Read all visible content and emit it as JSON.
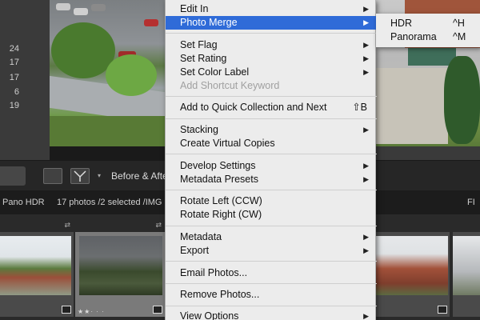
{
  "left_panel": {
    "numbers": [
      "24",
      "17",
      "17",
      "6",
      "19"
    ]
  },
  "toolbar": {
    "before_after_label": "Before & After",
    "filter_label": "FI"
  },
  "filmbar": {
    "folder_label": "Pano HDR",
    "status_text": "17 photos /2 selected /IMG"
  },
  "filmstrip": {
    "rating_stars": "★★· · ·"
  },
  "menu": {
    "edit_in": "Edit In",
    "photo_merge": "Photo Merge",
    "set_flag": "Set Flag",
    "set_rating": "Set Rating",
    "set_color_label": "Set Color Label",
    "add_shortcut_keyword": "Add Shortcut Keyword",
    "add_quick_collection": "Add to Quick Collection and Next",
    "add_quick_collection_sc": "⇧B",
    "stacking": "Stacking",
    "create_virtual_copies": "Create Virtual Copies",
    "develop_settings": "Develop Settings",
    "metadata_presets": "Metadata Presets",
    "rotate_left": "Rotate Left (CCW)",
    "rotate_right": "Rotate Right (CW)",
    "metadata": "Metadata",
    "export": "Export",
    "email_photos": "Email Photos...",
    "remove_photos": "Remove Photos...",
    "view_options": "View Options"
  },
  "submenu": {
    "hdr": "HDR",
    "hdr_sc": "^H",
    "panorama": "Panorama",
    "panorama_sc": "^M"
  },
  "colors": {
    "highlight": "#2f6bd8",
    "menu_bg": "#ececec"
  },
  "icons": [
    "chevron-right-icon",
    "loupe-view-icon",
    "compare-view-icon",
    "stack-badge-icon",
    "swap-arrows-icon"
  ]
}
